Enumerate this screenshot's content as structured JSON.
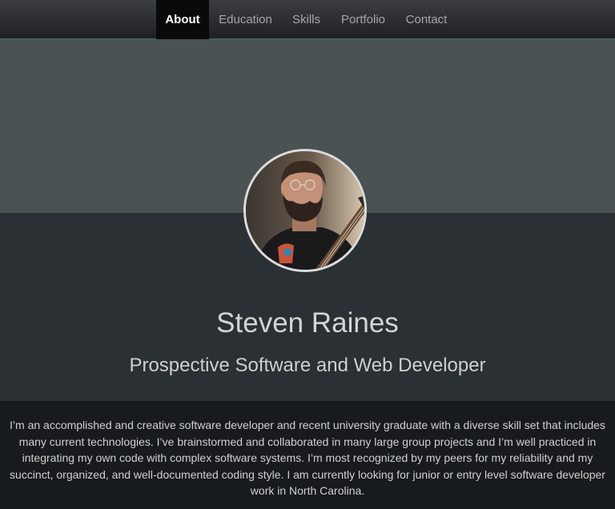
{
  "nav": {
    "items": [
      {
        "label": "About",
        "active": true
      },
      {
        "label": "Education",
        "active": false
      },
      {
        "label": "Skills",
        "active": false
      },
      {
        "label": "Portfolio",
        "active": false
      },
      {
        "label": "Contact",
        "active": false
      }
    ]
  },
  "profile": {
    "avatar_icon": "profile-photo",
    "name": "Steven Raines",
    "title": "Prospective Software and Web Developer",
    "bio": "I’m an accomplished and creative software developer and recent university graduate with a diverse skill set that includes many current technologies. I’ve brainstormed and collaborated in many large group projects and I’m well practiced in integrating my own code with complex software systems. I’m most recognized by my peers for my reliability and my succinct, organized, and well-documented coding style. I am currently looking for junior or entry level software developer work in North Carolina."
  },
  "colors": {
    "nav_bg": "#2c2f31",
    "nav_active_bg": "#0a0a0a",
    "band_top": "#4a5254",
    "band_mid": "#2a3033",
    "band_bottom": "#171b1d",
    "accent_line": "#3f6f7a"
  }
}
